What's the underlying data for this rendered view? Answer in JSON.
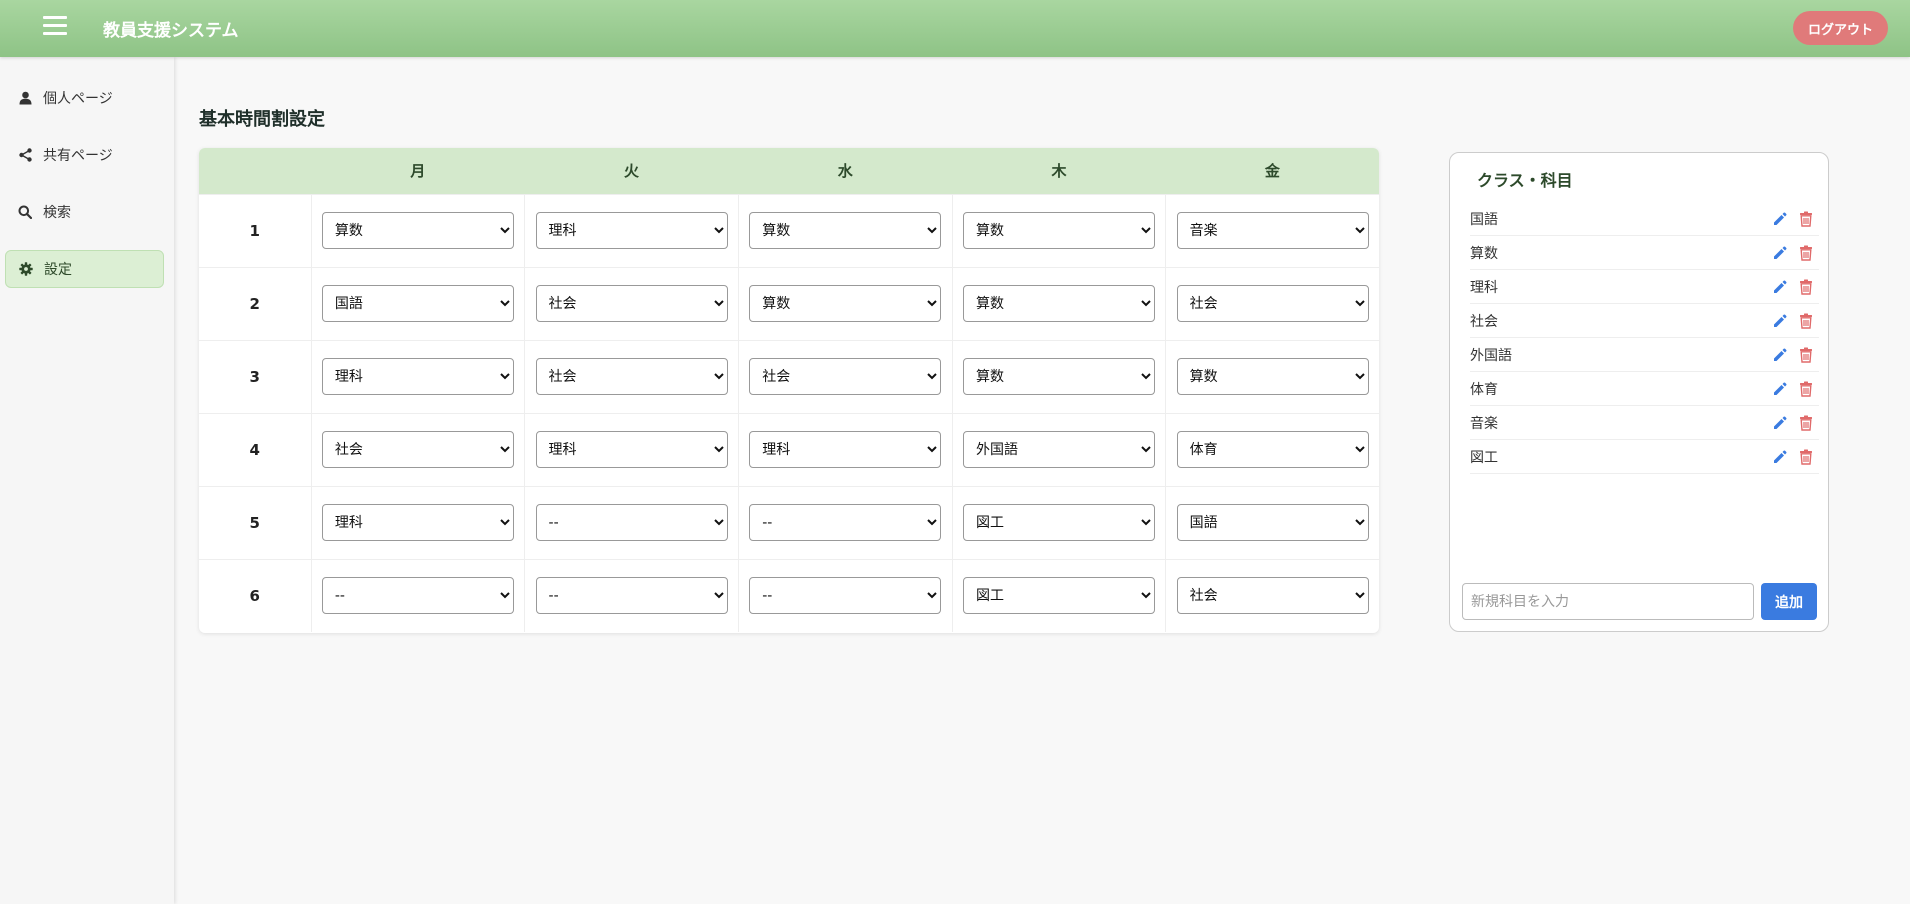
{
  "header": {
    "title": "教員支援システム",
    "logout_label": "ログアウト"
  },
  "sidebar": {
    "items": [
      {
        "label": "個人ページ",
        "icon": "user-icon"
      },
      {
        "label": "共有ページ",
        "icon": "share-icon"
      },
      {
        "label": "検索",
        "icon": "search-icon"
      },
      {
        "label": "設定",
        "icon": "gear-icon",
        "active": true
      }
    ]
  },
  "main": {
    "title": "基本時間割設定",
    "days": [
      "月",
      "火",
      "水",
      "木",
      "金"
    ],
    "periods": [
      {
        "label": "1",
        "cells": [
          "算数",
          "理科",
          "算数",
          "算数",
          "音楽"
        ]
      },
      {
        "label": "2",
        "cells": [
          "国語",
          "社会",
          "算数",
          "算数",
          "社会"
        ]
      },
      {
        "label": "3",
        "cells": [
          "理科",
          "社会",
          "社会",
          "算数",
          "算数"
        ]
      },
      {
        "label": "4",
        "cells": [
          "社会",
          "理科",
          "理科",
          "外国語",
          "体育"
        ]
      },
      {
        "label": "5",
        "cells": [
          "理科",
          "--",
          "--",
          "図工",
          "国語"
        ]
      },
      {
        "label": "6",
        "cells": [
          "--",
          "--",
          "--",
          "図工",
          "社会"
        ]
      }
    ]
  },
  "panel": {
    "title": "クラス・科目",
    "subjects": [
      "国語",
      "算数",
      "理科",
      "社会",
      "外国語",
      "体育",
      "音楽",
      "図工"
    ],
    "input_placeholder": "新規科目を入力",
    "add_label": "追加"
  },
  "colors": {
    "header": "#97c98e",
    "logout": "#e07a7a",
    "active_item": "#dcefd4",
    "table_header": "#d4e9cc",
    "edit_icon": "#3a7be0",
    "delete_icon": "#e06a6a",
    "add_button": "#3a7be0"
  }
}
